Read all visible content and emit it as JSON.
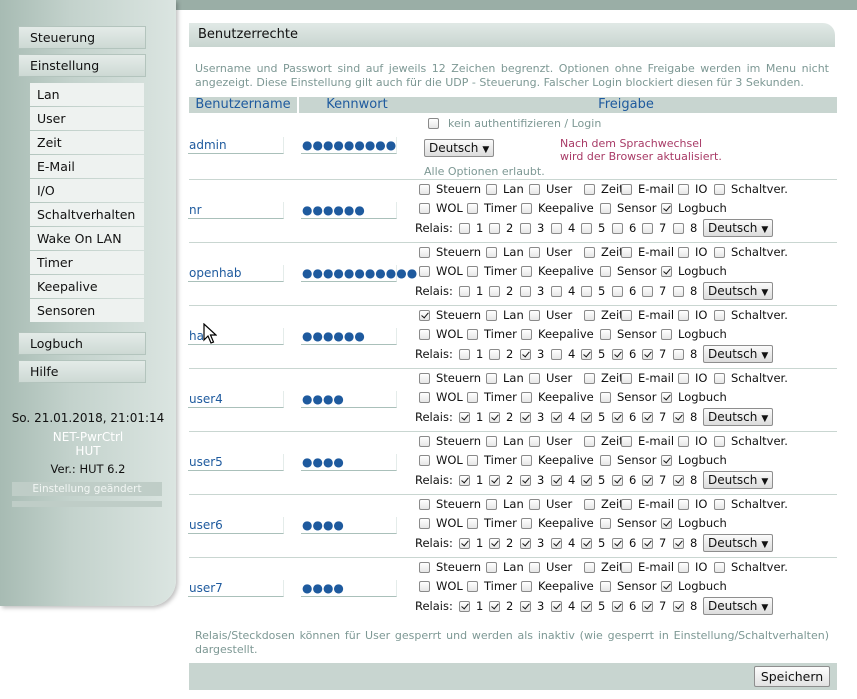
{
  "sidebar": {
    "menu": [
      {
        "label": "Steuerung"
      },
      {
        "label": "Einstellung"
      }
    ],
    "submenu": [
      {
        "label": "Lan"
      },
      {
        "label": "User"
      },
      {
        "label": "Zeit"
      },
      {
        "label": "E-Mail"
      },
      {
        "label": "I/O"
      },
      {
        "label": "Schaltverhalten"
      },
      {
        "label": "Wake On LAN"
      },
      {
        "label": "Timer"
      },
      {
        "label": "Keepalive"
      },
      {
        "label": "Sensoren"
      }
    ],
    "menu_bottom": [
      {
        "label": "Logbuch"
      },
      {
        "label": "Hilfe"
      }
    ],
    "datetime": "So. 21.01.2018, 21:01:14",
    "device_line1": "NET-PwrCtrl",
    "device_line2": "HUT",
    "version_label": "Ver.:",
    "version": "HUT 6.2",
    "status": "Einstellung geändert"
  },
  "main": {
    "title": "Benutzerrechte",
    "intro": "Username und Passwort sind auf jeweils 12 Zeichen begrenzt. Optionen ohne Freigabe werden im Menu nicht angezeigt. Diese Einstellung gilt auch für die UDP - Steuerung. Falscher Login blockiert diesen für 3 Sekunden.",
    "columns": {
      "user": "Benutzername",
      "password": "Kennwort",
      "perm": "Freigabe"
    },
    "admin": {
      "name": "admin",
      "password": "●●●●●●●●●",
      "auth_label": "kein authentifizieren / Login",
      "language": "Deutsch",
      "note_line1": "Nach dem Sprachwechsel",
      "note_line2": "wird der Browser aktualisiert.",
      "all_options": "Alle Optionen erlaubt."
    },
    "perm_labels": {
      "steuern": "Steuern",
      "lan": "Lan",
      "user": "User",
      "zeit": "Zeit",
      "email": "E-mail",
      "io": "IO",
      "schalt": "Schaltver.",
      "wol": "WOL",
      "timer": "Timer",
      "keepalive": "Keepalive",
      "sensor": "Sensor",
      "logbuch": "Logbuch",
      "relais": "Relais:"
    },
    "relay_numbers": [
      "1",
      "2",
      "3",
      "4",
      "5",
      "6",
      "7",
      "8"
    ],
    "users": [
      {
        "name": "nr",
        "password": "●●●●●●",
        "language": "Deutsch",
        "row1": [
          false,
          false,
          false,
          false,
          false,
          false,
          false
        ],
        "row2": [
          false,
          false,
          false,
          false,
          true
        ],
        "relays": [
          false,
          false,
          false,
          false,
          false,
          false,
          false,
          false
        ]
      },
      {
        "name": "openhab",
        "password": "●●●●●●●●●●●",
        "language": "Deutsch",
        "row1": [
          false,
          false,
          false,
          false,
          false,
          false,
          false
        ],
        "row2": [
          false,
          false,
          false,
          false,
          true
        ],
        "relays": [
          false,
          false,
          false,
          false,
          false,
          false,
          false,
          false
        ]
      },
      {
        "name": "ha",
        "password": "●●●●●●",
        "language": "Deutsch",
        "row1": [
          true,
          false,
          false,
          false,
          false,
          false,
          false
        ],
        "row2": [
          false,
          false,
          false,
          false,
          false
        ],
        "relays": [
          false,
          false,
          true,
          false,
          true,
          true,
          true,
          false
        ]
      },
      {
        "name": "user4",
        "password": "●●●●",
        "language": "Deutsch",
        "row1": [
          false,
          false,
          false,
          false,
          false,
          false,
          false
        ],
        "row2": [
          false,
          false,
          false,
          false,
          true
        ],
        "relays": [
          true,
          true,
          true,
          true,
          true,
          true,
          true,
          true
        ]
      },
      {
        "name": "user5",
        "password": "●●●●",
        "language": "Deutsch",
        "row1": [
          false,
          false,
          false,
          false,
          false,
          false,
          false
        ],
        "row2": [
          false,
          false,
          false,
          false,
          true
        ],
        "relays": [
          true,
          true,
          true,
          true,
          true,
          true,
          true,
          true
        ]
      },
      {
        "name": "user6",
        "password": "●●●●",
        "language": "Deutsch",
        "row1": [
          false,
          false,
          false,
          false,
          false,
          false,
          false
        ],
        "row2": [
          false,
          false,
          false,
          false,
          true
        ],
        "relays": [
          true,
          true,
          true,
          true,
          true,
          true,
          true,
          true
        ]
      },
      {
        "name": "user7",
        "password": "●●●●",
        "language": "Deutsch",
        "row1": [
          false,
          false,
          false,
          false,
          false,
          false,
          false
        ],
        "row2": [
          false,
          false,
          false,
          false,
          true
        ],
        "relays": [
          true,
          true,
          true,
          true,
          true,
          true,
          true,
          true
        ]
      }
    ],
    "footer_note": "Relais/Steckdosen können für User gesperrt und werden als inaktiv (wie gesperrt in Einstellung/Schaltverhalten) dargestellt.",
    "save_label": "Speichern"
  }
}
